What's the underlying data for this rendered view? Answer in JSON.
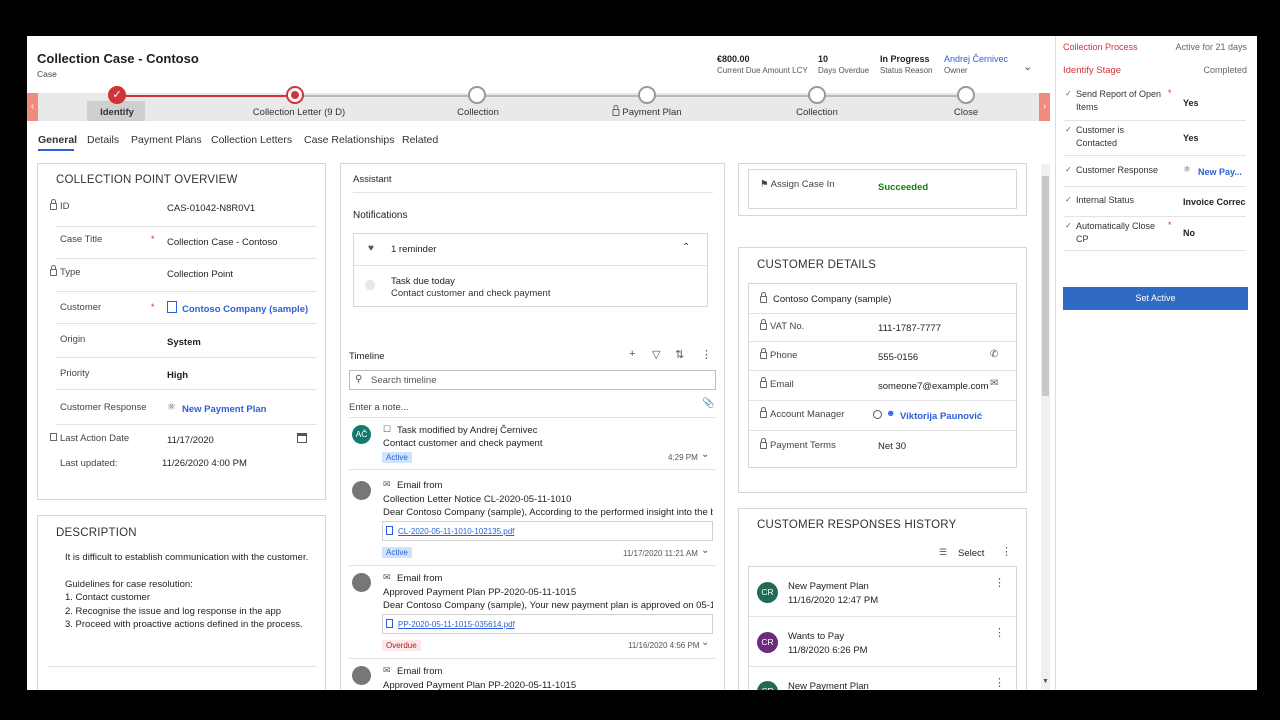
{
  "header": {
    "title": "Collection Case -  Contoso",
    "subtitle": "Case",
    "stats": [
      {
        "value": "€800.00",
        "label": "Current Due Amount LCY"
      },
      {
        "value": "10",
        "label": "Days Overdue"
      },
      {
        "value": "In Progress",
        "label": "Status Reason"
      },
      {
        "value": "Andrej Černivec",
        "label": "Owner"
      }
    ]
  },
  "stages": [
    {
      "label": "Identify"
    },
    {
      "label": "Collection Letter  (9 D)"
    },
    {
      "label": "Collection"
    },
    {
      "label": "Payment Plan"
    },
    {
      "label": "Collection"
    },
    {
      "label": "Close"
    }
  ],
  "tabs": [
    "General",
    "Details",
    "Payment Plans",
    "Collection Letters",
    "Case Relationships",
    "Related"
  ],
  "overview": {
    "title": "COLLECTION POINT OVERVIEW",
    "fields": {
      "id": {
        "label": "ID",
        "value": "CAS-01042-N8R0V1"
      },
      "case_title": {
        "label": "Case Title",
        "value": "Collection Case -  Contoso"
      },
      "type": {
        "label": "Type",
        "value": "Collection Point"
      },
      "customer": {
        "label": "Customer",
        "value": "Contoso Company (sample)"
      },
      "origin": {
        "label": "Origin",
        "value": "System"
      },
      "priority": {
        "label": "Priority",
        "value": "High"
      },
      "customer_response": {
        "label": "Customer Response",
        "value": "New Payment Plan"
      },
      "last_action_date": {
        "label": "Last Action Date",
        "value": "11/17/2020"
      },
      "last_updated": {
        "label": "Last updated:",
        "value": "11/26/2020 4:00 PM"
      }
    }
  },
  "description": {
    "title": "DESCRIPTION",
    "lines": [
      "It is difficult to establish communication with the customer.",
      "Guidelines for case resolution:",
      "1. Contact customer",
      "2. Recognise the issue and log response in the app",
      "3. Proceed with proactive actions defined in the process."
    ]
  },
  "assistant": {
    "title": "Assistant",
    "notifications": "Notifications",
    "reminder": "1 reminder",
    "task_title": "Task due today",
    "task_desc": "Contact customer and check payment"
  },
  "timeline": {
    "title": "Timeline",
    "search_placeholder": "Search timeline",
    "note_placeholder": "Enter a note...",
    "items": [
      {
        "initials": "AČ",
        "title": "Task modified by Andrej Černivec",
        "line1": "Contact customer and check payment",
        "line2": "",
        "attachment": "",
        "badge": "Active",
        "time": "4:29 PM"
      },
      {
        "initials": "",
        "title": "Email from",
        "line1": "Collection Letter Notice CL-2020-05-11-1010",
        "line2": "Dear Contoso Company (sample), According to the performed insight into the b...",
        "attachment": "CL-2020-05-11-1010-102135.pdf",
        "badge": "Active",
        "time": "11/17/2020 11:21 AM"
      },
      {
        "initials": "",
        "title": "Email from",
        "line1": "Approved Payment Plan PP-2020-05-11-1015",
        "line2": "Dear Contoso Company (sample), Your new payment plan is approved on 05-11...",
        "attachment": "PP-2020-05-11-1015-035614.pdf",
        "badge": "Overdue",
        "time": "11/16/2020 4:56 PM"
      },
      {
        "initials": "",
        "title": "Email from",
        "line1": "Approved Payment Plan PP-2020-05-11-1015",
        "line2": "",
        "attachment": "",
        "badge": "",
        "time": ""
      }
    ]
  },
  "assign": {
    "label": "Assign Case In",
    "value": "Succeeded"
  },
  "customer_details": {
    "title": "CUSTOMER DETAILS",
    "company": "Contoso Company (sample)",
    "fields": [
      {
        "label": "VAT No.",
        "value": "111-1787-7777"
      },
      {
        "label": "Phone",
        "value": "555-0156"
      },
      {
        "label": "Email",
        "value": "someone7@example.com"
      },
      {
        "label": "Account Manager",
        "value": "Viktorija Paunović"
      },
      {
        "label": "Payment Terms",
        "value": "Net 30"
      }
    ]
  },
  "responses": {
    "title": "CUSTOMER RESPONSES HISTORY",
    "select": "Select",
    "items": [
      {
        "initials": "CR",
        "title": "New Payment Plan",
        "date": "11/16/2020 12:47 PM",
        "color": "#1e6b5a"
      },
      {
        "initials": "CR",
        "title": "Wants to Pay",
        "date": "11/8/2020 6:26 PM",
        "color": "#6b2a7e"
      },
      {
        "initials": "CR",
        "title": "New Payment Plan",
        "date": "",
        "color": "#1e6b5a"
      }
    ]
  },
  "process_panel": {
    "process": "Collection Process",
    "active_for": "Active for 21 days",
    "stage": "Identify Stage",
    "status": "Completed",
    "fields": [
      {
        "label": "Send Report of Open Items",
        "value": "Yes",
        "required": true
      },
      {
        "label": "Customer is Contacted",
        "value": "Yes",
        "required": false
      },
      {
        "label": "Customer Response",
        "value": "New Pay...",
        "required": false
      },
      {
        "label": "Internal Status",
        "value": "Invoice Correc",
        "required": false
      },
      {
        "label": "Automatically Close CP",
        "value": "No",
        "required": true
      }
    ],
    "button": "Set Active"
  },
  "colors": {
    "accent": "#d13438",
    "link": "#2b5fd9",
    "primary_button": "#2f6bc4"
  }
}
